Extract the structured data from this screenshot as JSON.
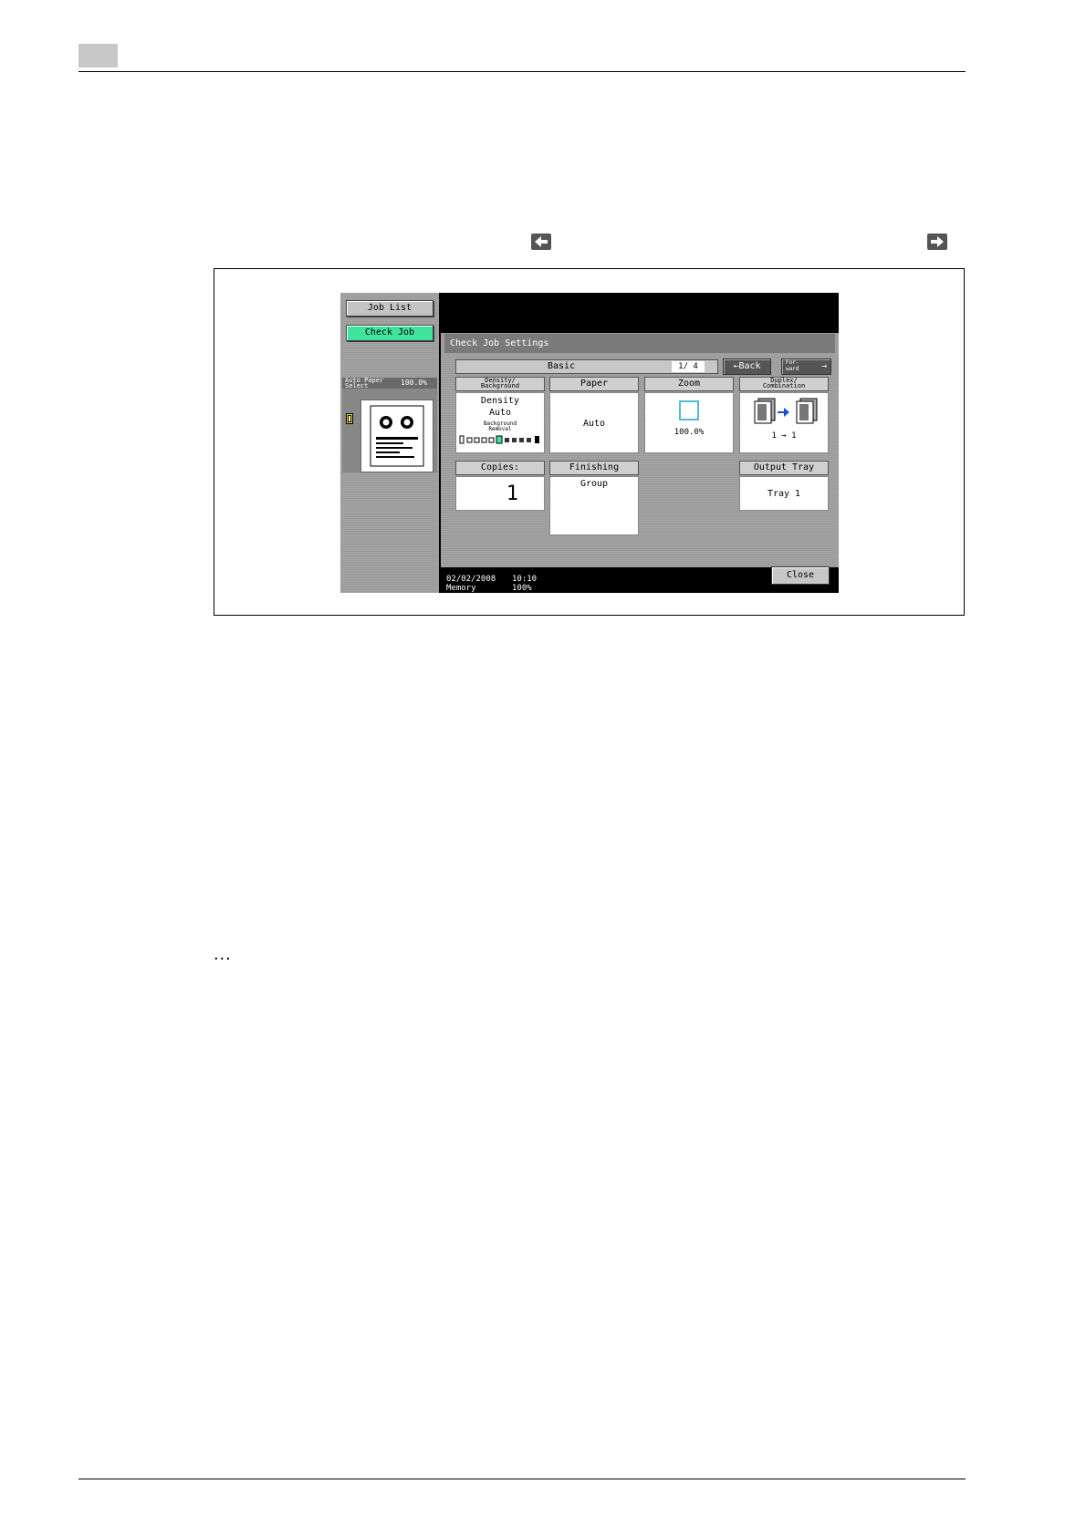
{
  "screen": {
    "side": {
      "job_list": "Job List",
      "check_job": "Check Job"
    },
    "preview": {
      "paper_label": "Auto Paper\nSelect",
      "zoom": "100.0%"
    },
    "dialog_title": "Check Job Settings",
    "tab": {
      "label": "Basic",
      "page_indicator": "1/ 4"
    },
    "back_btn": "←Back",
    "forward_btn": "For-\nward",
    "cells": {
      "density": {
        "header": "Density/\nBackground",
        "line1": "Density",
        "line2": "Auto",
        "sub": "Background\nRemoval"
      },
      "paper": {
        "header": "Paper",
        "value": "Auto"
      },
      "zoom": {
        "header": "Zoom",
        "value": "100.0%"
      },
      "duplex": {
        "header": "Duplex/\nCombination",
        "value": "1 → 1"
      },
      "copies": {
        "header": "Copies:",
        "value": "1"
      },
      "finishing": {
        "header": "Finishing",
        "value": "Group"
      },
      "output_tray": {
        "header": "Output Tray",
        "value": "Tray 1"
      }
    },
    "status": {
      "date": "02/02/2008",
      "time": "10:10",
      "memory_label": "Memory",
      "memory_value": "100%"
    },
    "close_btn": "Close"
  },
  "doc": {
    "ellipsis": "..."
  },
  "icons": {
    "nav_left": "left-arrow-icon",
    "nav_right": "right-arrow-icon",
    "paper": "paper-tray-icon",
    "zoom": "zoom-square-icon",
    "duplex": "duplex-pages-icon"
  },
  "colors": {
    "check_job": "#3ee39c",
    "screen_bg": "#000000",
    "panel_gray": "#a0a0a0",
    "title_bar": "#7a7a7a"
  }
}
